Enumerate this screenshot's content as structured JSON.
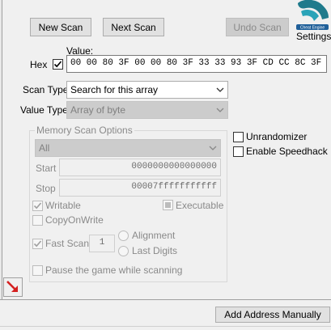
{
  "buttons": {
    "new_scan": "New Scan",
    "next_scan": "Next Scan",
    "undo_scan": "Undo Scan",
    "add_address_manually": "Add Address Manually"
  },
  "settings_label": "Settings",
  "value": {
    "label": "Value:",
    "hex_label": "Hex",
    "hex_checked": true,
    "input": "00 00 80 3F 00 00 80 3F 33 33 93 3F CD CC 8C 3F"
  },
  "scan_type": {
    "label": "Scan Type",
    "selected": "Search for this array"
  },
  "value_type": {
    "label": "Value Type",
    "selected": "Array of byte"
  },
  "memory_scan": {
    "title": "Memory Scan Options",
    "region": "All",
    "start_label": "Start",
    "start_value": "0000000000000000",
    "stop_label": "Stop",
    "stop_value": "00007fffffffffff",
    "writable": {
      "label": "Writable",
      "checked": true
    },
    "executable": {
      "label": "Executable",
      "checked": false
    },
    "copy_on_write": {
      "label": "CopyOnWrite",
      "checked": false
    },
    "fast_scan": {
      "label": "Fast Scan",
      "checked": true,
      "value": "1"
    },
    "alignment": "Alignment",
    "last_digits": "Last Digits",
    "pause_game": {
      "label": "Pause the game while scanning",
      "checked": false
    }
  },
  "unrandomizer": {
    "label": "Unrandomizer",
    "checked": false
  },
  "speedhack": {
    "label": "Enable Speedhack",
    "checked": false
  },
  "icons": [
    "cheat-engine-logo-icon",
    "red-arrow-icon",
    "chevron-down-icon",
    "checkmark-icon"
  ]
}
